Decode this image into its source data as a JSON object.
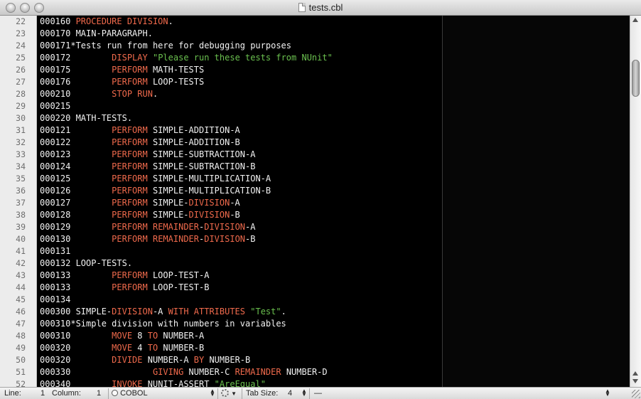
{
  "window": {
    "title": "tests.cbl"
  },
  "editor": {
    "line_numbers": [
      "22",
      "23",
      "24",
      "25",
      "26",
      "27",
      "28",
      "29",
      "30",
      "31",
      "32",
      "33",
      "34",
      "35",
      "36",
      "37",
      "38",
      "39",
      "40",
      "41",
      "42",
      "43",
      "44",
      "45",
      "46",
      "47",
      "48",
      "49",
      "50",
      "51",
      "52"
    ],
    "lines": [
      [
        [
          "t",
          "000160 "
        ],
        [
          "k",
          "PROCEDURE DIVISION"
        ],
        [
          "t",
          "."
        ]
      ],
      [
        [
          "t",
          "000170 MAIN-PARAGRAPH."
        ]
      ],
      [
        [
          "t",
          "000171*Tests run from here for debugging purposes"
        ]
      ],
      [
        [
          "t",
          "000172        "
        ],
        [
          "k",
          "DISPLAY"
        ],
        [
          "t",
          " "
        ],
        [
          "s",
          "\"Please run these tests from NUnit\""
        ]
      ],
      [
        [
          "t",
          "000175        "
        ],
        [
          "k",
          "PERFORM"
        ],
        [
          "t",
          " MATH-TESTS"
        ]
      ],
      [
        [
          "t",
          "000176        "
        ],
        [
          "k",
          "PERFORM"
        ],
        [
          "t",
          " LOOP-TESTS"
        ]
      ],
      [
        [
          "t",
          "000210        "
        ],
        [
          "k",
          "STOP RUN"
        ],
        [
          "t",
          "."
        ]
      ],
      [
        [
          "t",
          "000215"
        ]
      ],
      [
        [
          "t",
          "000220 MATH-TESTS."
        ]
      ],
      [
        [
          "t",
          "000121        "
        ],
        [
          "k",
          "PERFORM"
        ],
        [
          "t",
          " SIMPLE-ADDITION-A"
        ]
      ],
      [
        [
          "t",
          "000122        "
        ],
        [
          "k",
          "PERFORM"
        ],
        [
          "t",
          " SIMPLE-ADDITION-B"
        ]
      ],
      [
        [
          "t",
          "000123        "
        ],
        [
          "k",
          "PERFORM"
        ],
        [
          "t",
          " SIMPLE-SUBTRACTION-A"
        ]
      ],
      [
        [
          "t",
          "000124        "
        ],
        [
          "k",
          "PERFORM"
        ],
        [
          "t",
          " SIMPLE-SUBTRACTION-B"
        ]
      ],
      [
        [
          "t",
          "000125        "
        ],
        [
          "k",
          "PERFORM"
        ],
        [
          "t",
          " SIMPLE-MULTIPLICATION-A"
        ]
      ],
      [
        [
          "t",
          "000126        "
        ],
        [
          "k",
          "PERFORM"
        ],
        [
          "t",
          " SIMPLE-MULTIPLICATION-B"
        ]
      ],
      [
        [
          "t",
          "000127        "
        ],
        [
          "k",
          "PERFORM"
        ],
        [
          "t",
          " SIMPLE-"
        ],
        [
          "k",
          "DIVISION"
        ],
        [
          "t",
          "-A"
        ]
      ],
      [
        [
          "t",
          "000128        "
        ],
        [
          "k",
          "PERFORM"
        ],
        [
          "t",
          " SIMPLE-"
        ],
        [
          "k",
          "DIVISION"
        ],
        [
          "t",
          "-B"
        ]
      ],
      [
        [
          "t",
          "000129        "
        ],
        [
          "k",
          "PERFORM"
        ],
        [
          "t",
          " "
        ],
        [
          "k",
          "REMAINDER"
        ],
        [
          "t",
          "-"
        ],
        [
          "k",
          "DIVISION"
        ],
        [
          "t",
          "-A"
        ]
      ],
      [
        [
          "t",
          "000130        "
        ],
        [
          "k",
          "PERFORM"
        ],
        [
          "t",
          " "
        ],
        [
          "k",
          "REMAINDER"
        ],
        [
          "t",
          "-"
        ],
        [
          "k",
          "DIVISION"
        ],
        [
          "t",
          "-B"
        ]
      ],
      [
        [
          "t",
          "000131"
        ]
      ],
      [
        [
          "t",
          "000132 LOOP-TESTS."
        ]
      ],
      [
        [
          "t",
          "000133        "
        ],
        [
          "k",
          "PERFORM"
        ],
        [
          "t",
          " LOOP-TEST-A"
        ]
      ],
      [
        [
          "t",
          "000133        "
        ],
        [
          "k",
          "PERFORM"
        ],
        [
          "t",
          " LOOP-TEST-B"
        ]
      ],
      [
        [
          "t",
          "000134"
        ]
      ],
      [
        [
          "t",
          "000300 SIMPLE-"
        ],
        [
          "k",
          "DIVISION"
        ],
        [
          "t",
          "-A "
        ],
        [
          "k",
          "WITH ATTRIBUTES"
        ],
        [
          "t",
          " "
        ],
        [
          "s",
          "\"Test\""
        ],
        [
          "t",
          "."
        ]
      ],
      [
        [
          "t",
          "000310*Simple division with numbers in variables"
        ]
      ],
      [
        [
          "t",
          "000310        "
        ],
        [
          "k",
          "MOVE"
        ],
        [
          "t",
          " 8 "
        ],
        [
          "k",
          "TO"
        ],
        [
          "t",
          " NUMBER-A"
        ]
      ],
      [
        [
          "t",
          "000320        "
        ],
        [
          "k",
          "MOVE"
        ],
        [
          "t",
          " 4 "
        ],
        [
          "k",
          "TO"
        ],
        [
          "t",
          " NUMBER-B"
        ]
      ],
      [
        [
          "t",
          "000320        "
        ],
        [
          "k",
          "DIVIDE"
        ],
        [
          "t",
          " NUMBER-A "
        ],
        [
          "k",
          "BY"
        ],
        [
          "t",
          " NUMBER-B"
        ]
      ],
      [
        [
          "t",
          "000330                "
        ],
        [
          "k",
          "GIVING"
        ],
        [
          "t",
          " NUMBER-C "
        ],
        [
          "k",
          "REMAINDER"
        ],
        [
          "t",
          " NUMBER-D"
        ]
      ],
      [
        [
          "t",
          "000340        "
        ],
        [
          "k",
          "INVOKE"
        ],
        [
          "t",
          " NUNIT-ASSERT "
        ],
        [
          "s",
          "\"AreEqual\""
        ]
      ]
    ],
    "colors": {
      "background": "#000000",
      "keyword": "#f06a4c",
      "string": "#6bc14f",
      "text": "#f2f2f2"
    }
  },
  "statusbar": {
    "line_label": "Line:",
    "line_value": "1",
    "column_label": "Column:",
    "column_value": "1",
    "language": "COBOL",
    "tab_size_label": "Tab Size:",
    "tab_size_value": "4",
    "symbol": "—"
  }
}
